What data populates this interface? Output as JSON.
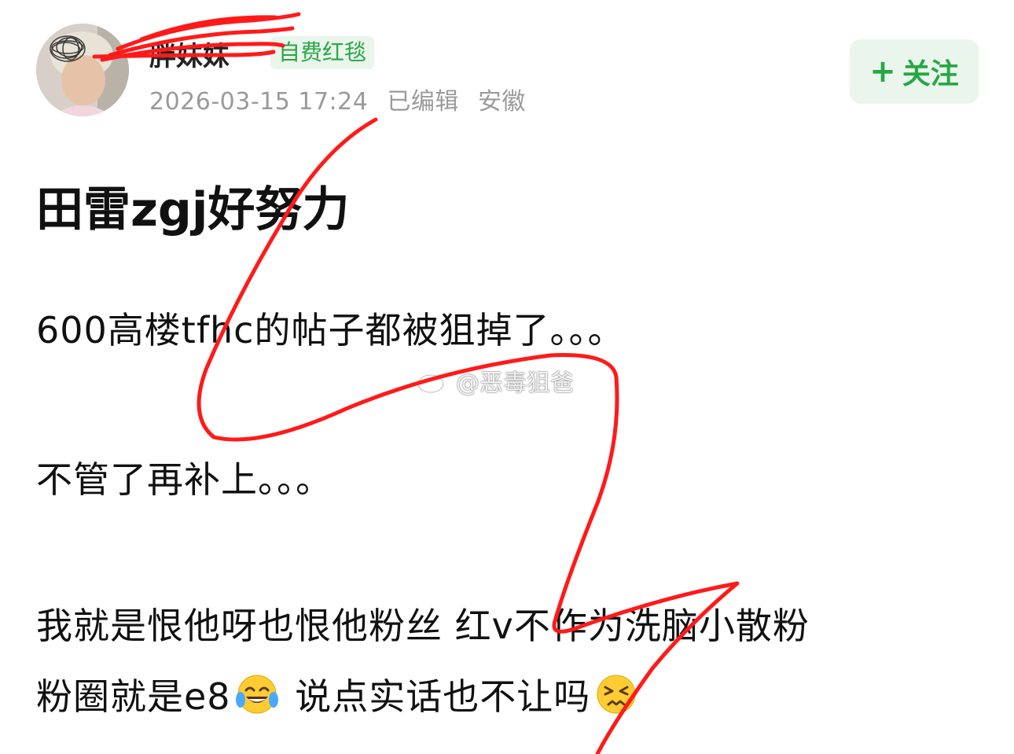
{
  "post": {
    "author": {
      "name": "胖妹妹",
      "badge": "自费红毯"
    },
    "meta": {
      "timestamp": "2026-03-15 17:24",
      "edited": "已编辑",
      "location": "安徽"
    },
    "follow_button": {
      "plus": "+",
      "label": "关注"
    },
    "title": "田雷zgj好努力",
    "paragraphs": {
      "p1": "600高楼tfhc的帖子都被狙掉了。。。",
      "p2": "不管了再补上。。。",
      "p3": "我就是恨他呀也恨他粉丝 红v不作为洗脑小散粉",
      "p4_a": "粉圈就是e8",
      "p4_b": " 说点实话也不让吗"
    },
    "emojis": [
      "tears-of-joy-emoji",
      "persevering-face-emoji"
    ]
  },
  "watermark": {
    "icon": "weibo-icon",
    "text": "@恶毒狙爸"
  },
  "colors": {
    "accent_green": "#28a745",
    "badge_bg": "#eaf6ec",
    "meta_gray": "#9a9a9a",
    "annotation_red": "#ff1a1a"
  }
}
